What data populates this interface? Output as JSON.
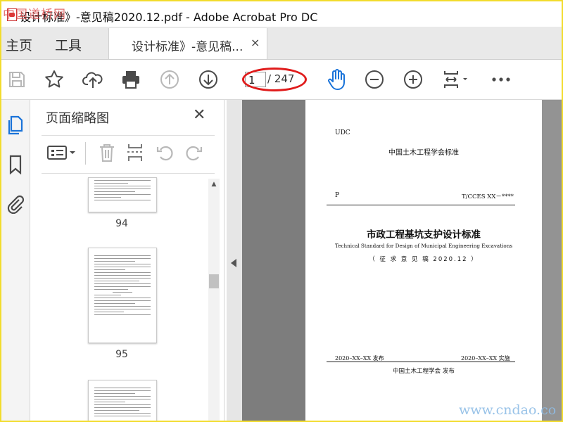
{
  "window": {
    "title": "设计标准》-意见稿2020.12.pdf - Adobe Acrobat Pro DC",
    "corner_watermark": "中国道桥网"
  },
  "tabs": {
    "home": "主页",
    "tools": "工具",
    "document": "设计标准》-意见稿...",
    "close_glyph": "×"
  },
  "toolbar": {
    "current_page": "1",
    "total_pages": "/ 247",
    "icons": [
      "save-icon",
      "star-icon",
      "cloud-upload-icon",
      "print-icon",
      "page-up-icon",
      "page-down-icon",
      "hand-icon",
      "zoom-out-icon",
      "zoom-in-icon",
      "fit-page-icon",
      "more-icon"
    ],
    "annotation_color": "#e01b1b"
  },
  "thumbnails": {
    "title": "页面缩略图",
    "close_glyph": "✕",
    "pages": [
      {
        "label": "94"
      },
      {
        "label": "95"
      },
      {
        "label": ""
      }
    ]
  },
  "page": {
    "udc": "UDC",
    "org_standard": "中国土木工程学会标准",
    "p": "P",
    "code": "T/CCES XX－****",
    "title_cn": "市政工程基坑支护设计标准",
    "title_en": "Technical Standard for Design of Municipal Engineering Excavations",
    "draft": "（ 征 求 意 见 稿  2020.12 ）",
    "issue": "2020–XX–XX  发布",
    "implement": "2020–XX–XX  实施",
    "publisher": "中国土木工程学会        发布"
  },
  "footer_watermark": "www.cndao.co",
  "colors": {
    "accent_blue": "#1a73d9",
    "frame": "#f2dc2c"
  }
}
